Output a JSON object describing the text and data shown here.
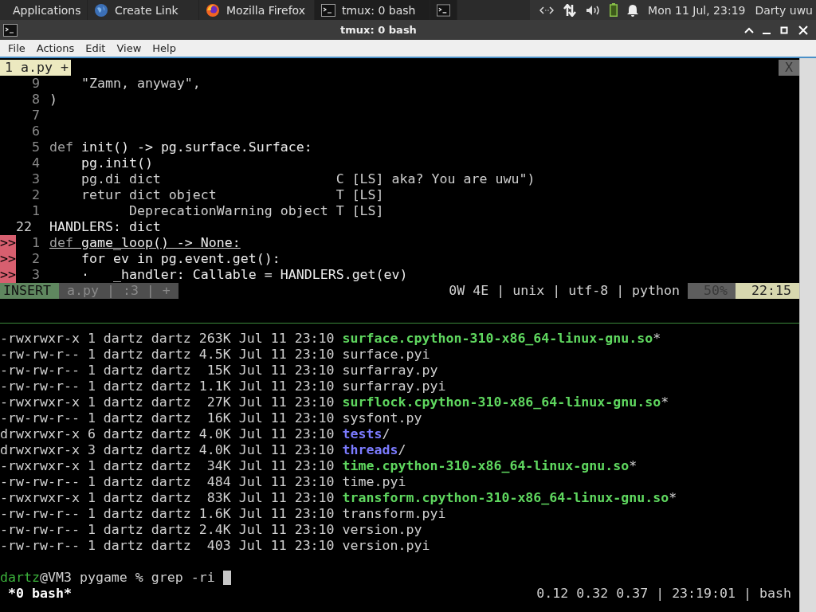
{
  "taskbar": {
    "tasks": [
      {
        "label": "Applications",
        "selected": false
      },
      {
        "label": "Create Link",
        "selected": false
      },
      {
        "label": "Mozilla Firefox",
        "selected": false
      },
      {
        "label": "tmux: 0 bash",
        "selected": true
      }
    ],
    "clock": "Mon 11 Jul, 23:19",
    "user": "Darty uwu"
  },
  "window": {
    "title": "tmux: 0 bash"
  },
  "menu": [
    "File",
    "Actions",
    "Edit",
    "View",
    "Help"
  ],
  "editor": {
    "tab": "1 a.py +",
    "close": "X",
    "lines": [
      {
        "number": "9",
        "sign": false,
        "current": false,
        "segments": [
          {
            "text": "    \"Zamn, anyway\",",
            "kind": "plain"
          }
        ]
      },
      {
        "number": "8",
        "sign": false,
        "current": false,
        "segments": [
          {
            "text": ")",
            "kind": "plain"
          }
        ]
      },
      {
        "number": "7",
        "sign": false,
        "current": false
      },
      {
        "number": "6",
        "sign": false,
        "current": false
      },
      {
        "number": "5",
        "sign": false,
        "current": false,
        "segments": [
          {
            "text": "def",
            "kind": "dim"
          },
          {
            "text": " init() -> pg.surface.Surface:",
            "kind": "bright"
          }
        ]
      },
      {
        "number": "4",
        "sign": false,
        "current": false,
        "segments": [
          {
            "text": "    pg.init()",
            "kind": "bright"
          }
        ]
      },
      {
        "number": "3",
        "sign": false,
        "current": false,
        "segments": [
          {
            "text": "    pg.di dict                      C [LS] aka? You are uwu\")",
            "kind": "plain"
          }
        ]
      },
      {
        "number": "2",
        "sign": false,
        "current": false,
        "segments": [
          {
            "text": "    retur dict object               T [LS]",
            "kind": "plain"
          }
        ]
      },
      {
        "number": "1",
        "sign": false,
        "current": false,
        "segments": [
          {
            "text": "          DeprecationWarning object T [LS]",
            "kind": "plain"
          }
        ]
      },
      {
        "number": "22",
        "sign": false,
        "current": true,
        "segments": [
          {
            "text": "HANDLERS: dict",
            "kind": "bright"
          }
        ]
      },
      {
        "number": "1",
        "sign": true,
        "current": false,
        "segments": [
          {
            "text": "def",
            "kind": "dim"
          },
          {
            "text": " game_loop() -> None:",
            "kind": "bright"
          }
        ]
      },
      {
        "number": "2",
        "sign": true,
        "current": false,
        "segments": [
          {
            "text": "    for ev in pg.event.get():",
            "kind": "bright"
          }
        ]
      },
      {
        "number": "3",
        "sign": true,
        "current": false,
        "segments": [
          {
            "text": "    ·   _handler: Callable = HANDLERS.get(ev)",
            "kind": "bright"
          }
        ]
      }
    ],
    "sign_text": ">>",
    "status": {
      "mode": "INSERT",
      "file": "a.py | :3 | +",
      "info": "0W 4E | unix | utf-8 | python",
      "percent": "50%",
      "position": "22:15"
    }
  },
  "listing": [
    {
      "info": "-rwxrwxr-x 1 dartz dartz 263K Jul 11 23:10",
      "name": "surface.cpython-310-x86_64-linux-gnu.so",
      "suffix": "*",
      "kind": "exe"
    },
    {
      "info": "-rw-rw-r-- 1 dartz dartz 4.5K Jul 11 23:10",
      "name": "surface.pyi",
      "kind": "file"
    },
    {
      "info": "-rw-rw-r-- 1 dartz dartz  15K Jul 11 23:10",
      "name": "surfarray.py",
      "kind": "file"
    },
    {
      "info": "-rw-rw-r-- 1 dartz dartz 1.1K Jul 11 23:10",
      "name": "surfarray.pyi",
      "kind": "file"
    },
    {
      "info": "-rwxrwxr-x 1 dartz dartz  27K Jul 11 23:10",
      "name": "surflock.cpython-310-x86_64-linux-gnu.so",
      "suffix": "*",
      "kind": "exe"
    },
    {
      "info": "-rw-rw-r-- 1 dartz dartz  16K Jul 11 23:10",
      "name": "sysfont.py",
      "kind": "file"
    },
    {
      "info": "drwxrwxr-x 6 dartz dartz 4.0K Jul 11 23:10",
      "name": "tests",
      "suffix": "/",
      "kind": "dir"
    },
    {
      "info": "drwxrwxr-x 3 dartz dartz 4.0K Jul 11 23:10",
      "name": "threads",
      "suffix": "/",
      "kind": "dir"
    },
    {
      "info": "-rwxrwxr-x 1 dartz dartz  34K Jul 11 23:10",
      "name": "time.cpython-310-x86_64-linux-gnu.so",
      "suffix": "*",
      "kind": "exe"
    },
    {
      "info": "-rw-rw-r-- 1 dartz dartz  484 Jul 11 23:10",
      "name": "time.pyi",
      "kind": "file"
    },
    {
      "info": "-rwxrwxr-x 1 dartz dartz  83K Jul 11 23:10",
      "name": "transform.cpython-310-x86_64-linux-gnu.so",
      "suffix": "*",
      "kind": "exe"
    },
    {
      "info": "-rw-rw-r-- 1 dartz dartz 1.6K Jul 11 23:10",
      "name": "transform.pyi",
      "kind": "file"
    },
    {
      "info": "-rw-rw-r-- 1 dartz dartz 2.4K Jul 11 23:10",
      "name": "version.py",
      "kind": "file"
    },
    {
      "info": "-rw-rw-r-- 1 dartz dartz  403 Jul 11 23:10",
      "name": "version.pyi",
      "kind": "file"
    }
  ],
  "prompt": {
    "user": "dartz",
    "rest": "@VM3 pygame % grep -ri"
  },
  "tmux": {
    "window": " *0 bash*",
    "right": "0.12 0.32 0.37 | 23:19:01 | bash"
  }
}
